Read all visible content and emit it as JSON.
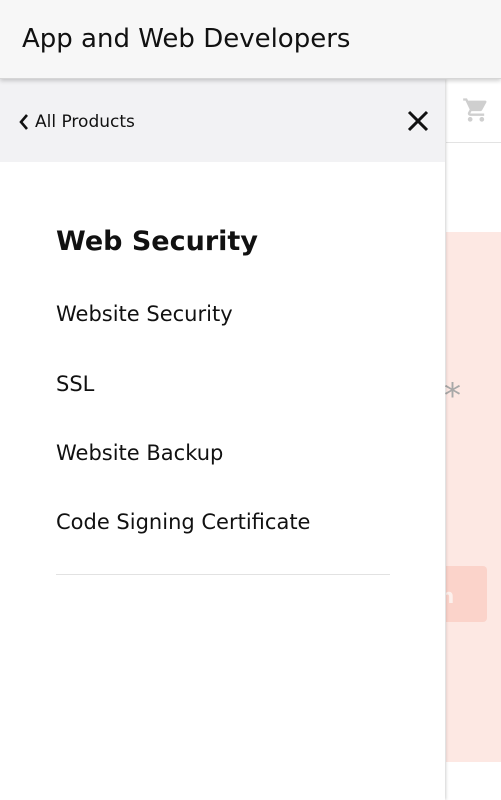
{
  "app_bar": {
    "title": "App and Web Developers"
  },
  "drawer": {
    "back_label": "All Products",
    "section_title": "Web Security",
    "items": [
      {
        "label": "Website Security"
      },
      {
        "label": "SSL"
      },
      {
        "label": "Website Backup"
      },
      {
        "label": "Code Signing Certificate"
      }
    ]
  },
  "background": {
    "asterisk": "*",
    "promo_button_label": "n"
  },
  "icons": {
    "back": "chevron-left-icon",
    "close": "close-icon",
    "cart": "cart-icon"
  },
  "colors": {
    "header_bg": "#f7f7f7",
    "drawer_header_bg": "#f2f2f4",
    "promo_bg": "#fde8e3",
    "promo_button": "#fbd3ca"
  }
}
